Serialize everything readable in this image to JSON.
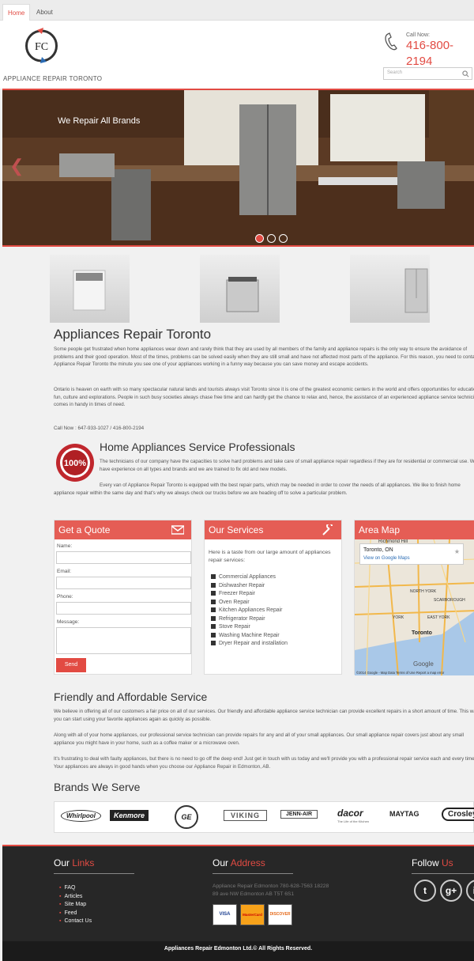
{
  "nav": {
    "home": "Home",
    "about": "About"
  },
  "header": {
    "logo_text": "FC",
    "brand": "APPLIANCE REPAIR TORONTO",
    "call_label": "Call Now:",
    "call_number": "416-800-2194",
    "search_placeholder": "Search"
  },
  "slider": {
    "caption": "We Repair All Brands",
    "active_slide": 1,
    "slides": 3
  },
  "main": {
    "title": "Appliances Repair Toronto",
    "para1": "Some people get frustrated when home appliances wear down and rarely think that they are used by all members of the family and appliance repairs is the only way to ensure the avoidance of problems and their good operation. Most of the times, problems can be solved easily when they are still small and have not affected most parts of the appliance. For this reason, you need to contact Appliance Repair Toronto the minute you see one of your appliances working in a funny way because you can save money and escape accidents.",
    "para2": "Ontario is heaven on earth with so many spectacular natural lands and tourists always visit Toronto since it is one of the greatest economic centers in the world and offers opportunities for education, fun, culture and explorations. People in such busy societies always chase free time and can hardly get the chance to relax and, hence, the assistance of an experienced appliance service technician comes in handy in times of need.",
    "call_now": "Call Now : 647-933-1027 / 416-800-2194",
    "badge_text": "100%",
    "pro_title": "Home Appliances Service Professionals",
    "pro_para1": "The technicians of our company have the capacities to solve hard problems and take care of small appliance repair regardless if they are for residential or commercial use. We have experience on all types and brands and we are trained to fix old and new models.",
    "pro_para2": "Every van of Appliance Repair Toronto is equipped with the best repair parts, which may be needed in order to cover the needs of all appliances. We like to finish home appliance repair within the same day and that's why we always check our trucks before we are heading off to solve a particular problem."
  },
  "quote": {
    "title": "Get a Quote",
    "name": "Name:",
    "email": "Email:",
    "phone": "Phone:",
    "message": "Message:",
    "send": "Send"
  },
  "services": {
    "title": "Our Services",
    "intro": "Here is a taste from our large amount of appliances repair services:",
    "items": [
      "Commercial Appliances",
      "Dishwasher Repair",
      "Freezer Repair",
      "Oven Repair",
      "Kitchen Appliances Repair",
      "Refrigerator Repair",
      "Stove Repair",
      "Washing Machine Repair",
      "Dryer Repair and installation"
    ]
  },
  "map": {
    "title": "Area Map",
    "place": "Toronto, ON",
    "link": "View on Google Maps",
    "labels": [
      "Richmond Hill",
      "NORTH YORK",
      "SCARBOROUGH",
      "YORK",
      "Toronto",
      "EAST YORK"
    ],
    "footer": "©2014 Google - Map Data   Terms of Use   Report a map error",
    "google": "Google"
  },
  "friendly": {
    "title": "Friendly and Affordable Service",
    "p1": "We believe in offering all of our customers a fair price on all of our services. Our friendly and affordable appliance service technician can provide excellent repairs in a short amount of time. This way, you can start using your favorite appliances again as quickly as possible.",
    "p2": "Along with all of your home appliances, our professional service technician can provide repairs for any and all of your small appliances. Our small appliance repair covers just about any small appliance you might have in your home, such as a coffee maker or a microwave oven.",
    "p3": "It's frustrating to deal with faulty appliances, but there is no need to go off the deep end! Just get in touch with us today and we'll provide you with a professional repair service each and every time. Your appliances are always in good hands when you choose our Appliance Repair in Edmonton, AB."
  },
  "brands": {
    "title": "Brands We Serve",
    "items": [
      "Whirlpool",
      "Kenmore",
      "GE",
      "VIKING",
      "JENN-AIR",
      "dacor",
      "MAYTAG",
      "Crosley"
    ],
    "dacor_tag": "The Life of the Kitchen"
  },
  "footer": {
    "links_title_1": "Our ",
    "links_title_2": "Links",
    "links": [
      "FAQ",
      "Articles",
      "Site Map",
      "Feed",
      "Contact Us"
    ],
    "address_title_1": "Our ",
    "address_title_2": "Address",
    "address": "Appliance Repair Edmonton 780-628-7563 18228 89 ave NW Edmonton AB T5T 6S1",
    "cards": [
      "VISA",
      "MasterCard",
      "DISCOVER"
    ],
    "follow_1": "Follow ",
    "follow_2": "Us",
    "social": [
      "twitter",
      "g+",
      "linkedin"
    ],
    "copyright": "Appliances Repair Edmonton Ltd.© All Rights Reserved."
  },
  "colors": {
    "accent": "#e24b43",
    "panel_header": "#e55d55",
    "footer_bg": "#272727"
  }
}
